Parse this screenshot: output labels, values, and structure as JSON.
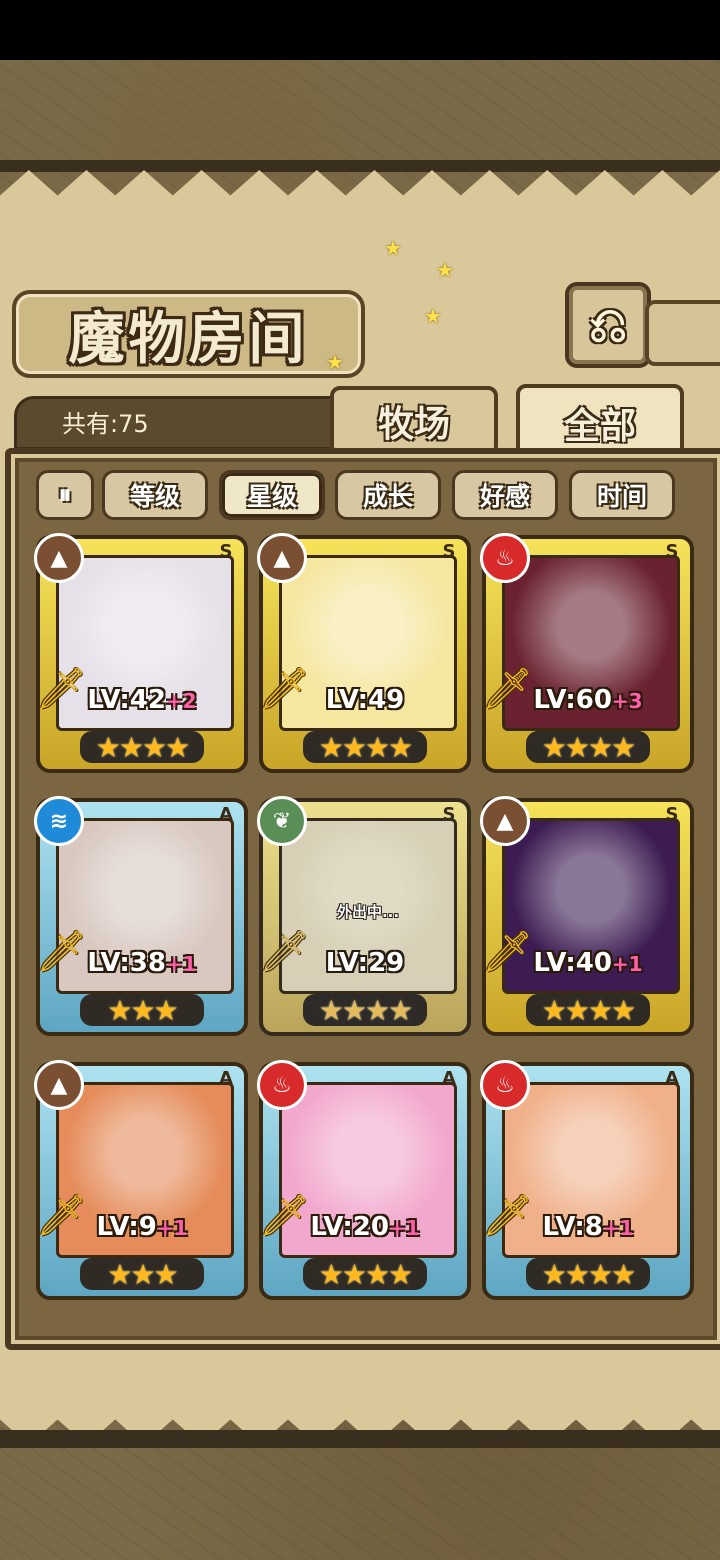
{
  "header": {
    "title": "魔物房间",
    "back_icon": "⎌"
  },
  "count": "共有:75",
  "tabs": [
    {
      "label": "牧场"
    },
    {
      "label": "全部"
    }
  ],
  "sort_buttons": [
    {
      "label": "等级"
    },
    {
      "label": "星级"
    },
    {
      "label": "成长"
    },
    {
      "label": "好感"
    },
    {
      "label": "时间"
    }
  ],
  "pause_label": "⏸",
  "monsters": [
    {
      "element": "earth",
      "rank": "S",
      "level": "LV:42",
      "plus": "+2",
      "stars": "★★★★",
      "frame": "gold",
      "portrait_color": "#e6e0e8",
      "away": ""
    },
    {
      "element": "earth",
      "rank": "S",
      "level": "LV:49",
      "plus": "",
      "stars": "★★★★",
      "frame": "gold",
      "portrait_color": "#f5e7a0",
      "away": ""
    },
    {
      "element": "fire",
      "rank": "S",
      "level": "LV:60",
      "plus": "+3",
      "stars": "★★★★",
      "frame": "gold",
      "portrait_color": "#6a2230",
      "away": ""
    },
    {
      "element": "water",
      "rank": "A",
      "level": "LV:38",
      "plus": "+1",
      "stars": "★★★",
      "frame": "blue",
      "portrait_color": "#d8c8c0",
      "away": ""
    },
    {
      "element": "wood",
      "rank": "S",
      "level": "LV:29",
      "plus": "",
      "stars": "★★★★",
      "frame": "gold",
      "portrait_color": "#c9c0a0",
      "away": "外出中..."
    },
    {
      "element": "earth",
      "rank": "S",
      "level": "LV:40",
      "plus": "+1",
      "stars": "★★★★",
      "frame": "gold",
      "portrait_color": "#3c1c52",
      "away": ""
    },
    {
      "element": "earth",
      "rank": "A",
      "level": "LV:9",
      "plus": "+1",
      "stars": "★★★",
      "frame": "blue",
      "portrait_color": "#e58c5a",
      "away": ""
    },
    {
      "element": "fire",
      "rank": "A",
      "level": "LV:20",
      "plus": "+1",
      "stars": "★★★★",
      "frame": "blue",
      "portrait_color": "#f2a7cd",
      "away": ""
    },
    {
      "element": "fire",
      "rank": "A",
      "level": "LV:8",
      "plus": "+1",
      "stars": "★★★★",
      "frame": "blue",
      "portrait_color": "#f0b089",
      "away": ""
    }
  ],
  "element_icons": {
    "earth": "▲",
    "fire": "♨",
    "water": "≋",
    "wood": "❦"
  }
}
